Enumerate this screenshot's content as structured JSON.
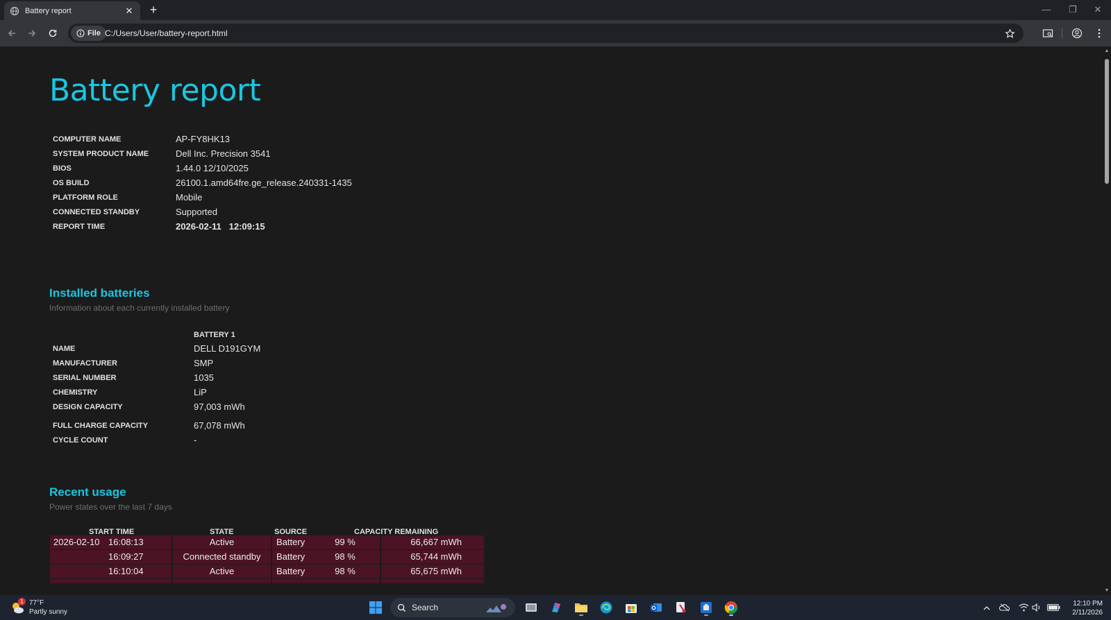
{
  "browser": {
    "tab_title": "Battery report",
    "omnibox_chip": "File",
    "url": "C:/Users/User/battery-report.html"
  },
  "report": {
    "title": "Battery report",
    "system_info": [
      {
        "label": "COMPUTER NAME",
        "value": "AP-FY8HK13"
      },
      {
        "label": "SYSTEM PRODUCT NAME",
        "value": "Dell Inc. Precision 3541"
      },
      {
        "label": "BIOS",
        "value": "1.44.0 12/10/2025"
      },
      {
        "label": "OS BUILD",
        "value": "26100.1.amd64fre.ge_release.240331-1435"
      },
      {
        "label": "PLATFORM ROLE",
        "value": "Mobile"
      },
      {
        "label": "CONNECTED STANDBY",
        "value": "Supported"
      },
      {
        "label": "REPORT TIME",
        "value": "2026-02-11   12:09:15"
      }
    ],
    "installed_batteries": {
      "heading": "Installed batteries",
      "subtitle": "Information about each currently installed battery",
      "column_header": "BATTERY 1",
      "rows": [
        {
          "label": "NAME",
          "value": "DELL D191GYM"
        },
        {
          "label": "MANUFACTURER",
          "value": "SMP"
        },
        {
          "label": "SERIAL NUMBER",
          "value": "1035"
        },
        {
          "label": "CHEMISTRY",
          "value": "LiP"
        },
        {
          "label": "DESIGN CAPACITY",
          "value": "97,003 mWh"
        },
        {
          "label": "FULL CHARGE CAPACITY",
          "value": "67,078 mWh"
        },
        {
          "label": "CYCLE COUNT",
          "value": "-"
        }
      ]
    },
    "recent_usage": {
      "heading": "Recent usage",
      "subtitle": "Power states over the last 7 days",
      "columns": [
        "START TIME",
        "STATE",
        "SOURCE",
        "CAPACITY REMAINING"
      ],
      "rows": [
        {
          "date": "2026-02-10",
          "time": "16:08:13",
          "state": "Active",
          "source": "Battery",
          "percent": "99 %",
          "mwh": "66,667 mWh"
        },
        {
          "date": "",
          "time": "16:09:27",
          "state": "Connected standby",
          "source": "Battery",
          "percent": "98 %",
          "mwh": "65,744 mWh"
        },
        {
          "date": "",
          "time": "16:10:04",
          "state": "Active",
          "source": "Battery",
          "percent": "98 %",
          "mwh": "65,675 mWh"
        }
      ]
    }
  },
  "taskbar": {
    "weather_temp": "77°F",
    "weather_desc": "Partly sunny",
    "weather_badge": "1",
    "search_label": "Search",
    "clock_time": "12:10 PM",
    "clock_date": "2/11/2026"
  },
  "colors": {
    "accent": "#1ac6e0",
    "row_fill": "#4b1324",
    "page_bg": "#1b1b1b"
  }
}
